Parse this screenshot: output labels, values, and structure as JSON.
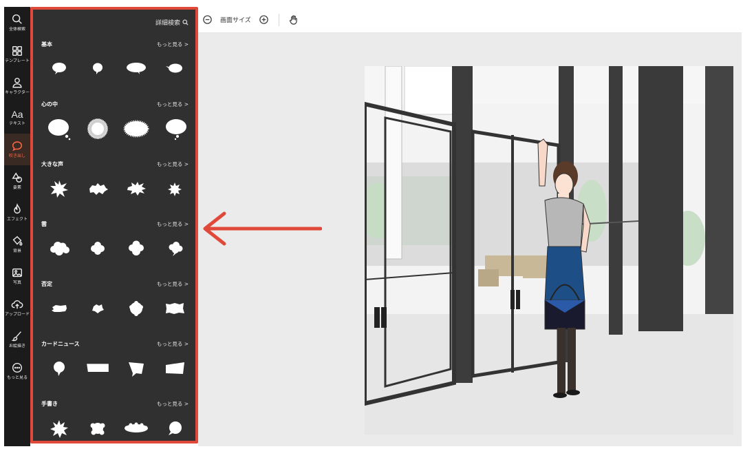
{
  "sidebar": {
    "items": [
      {
        "label": "全体検索",
        "icon": "search-icon"
      },
      {
        "label": "テンプレート",
        "icon": "template-grid-icon"
      },
      {
        "label": "キャラクター",
        "icon": "person-icon"
      },
      {
        "label": "テキスト",
        "icon": "text-aa-icon",
        "glyph": "Aa"
      },
      {
        "label": "吹き出し",
        "icon": "speech-bubble-icon",
        "active": true
      },
      {
        "label": "要素",
        "icon": "shapes-icon"
      },
      {
        "label": "エフェクト",
        "icon": "flame-icon"
      },
      {
        "label": "背景",
        "icon": "paint-bucket-icon"
      },
      {
        "label": "写真",
        "icon": "image-icon"
      },
      {
        "label": "アップロード",
        "icon": "cloud-upload-icon"
      },
      {
        "label": "お絵描き",
        "icon": "brush-icon"
      },
      {
        "label": "もっと見る",
        "icon": "more-dots-icon"
      }
    ]
  },
  "panel": {
    "advanced_search": "詳細検索",
    "sections": [
      {
        "title": "基本",
        "more": "もっと見る >"
      },
      {
        "title": "心の中",
        "more": "もっと見る >"
      },
      {
        "title": "大きな声",
        "more": "もっと見る >"
      },
      {
        "title": "雲",
        "more": "もっと見る >"
      },
      {
        "title": "否定",
        "more": "もっと見る >"
      },
      {
        "title": "カードニュース",
        "more": "もっと見る >"
      },
      {
        "title": "手書き",
        "more": "もっと見る >"
      }
    ]
  },
  "toolbar": {
    "zoom_label": "画面サイズ"
  },
  "colors": {
    "accent": "#ff6a45",
    "highlight_border": "#e0483a",
    "panel_bg": "#303030",
    "rail_bg": "#1b1b1b",
    "canvas_bg": "#ebebeb"
  }
}
